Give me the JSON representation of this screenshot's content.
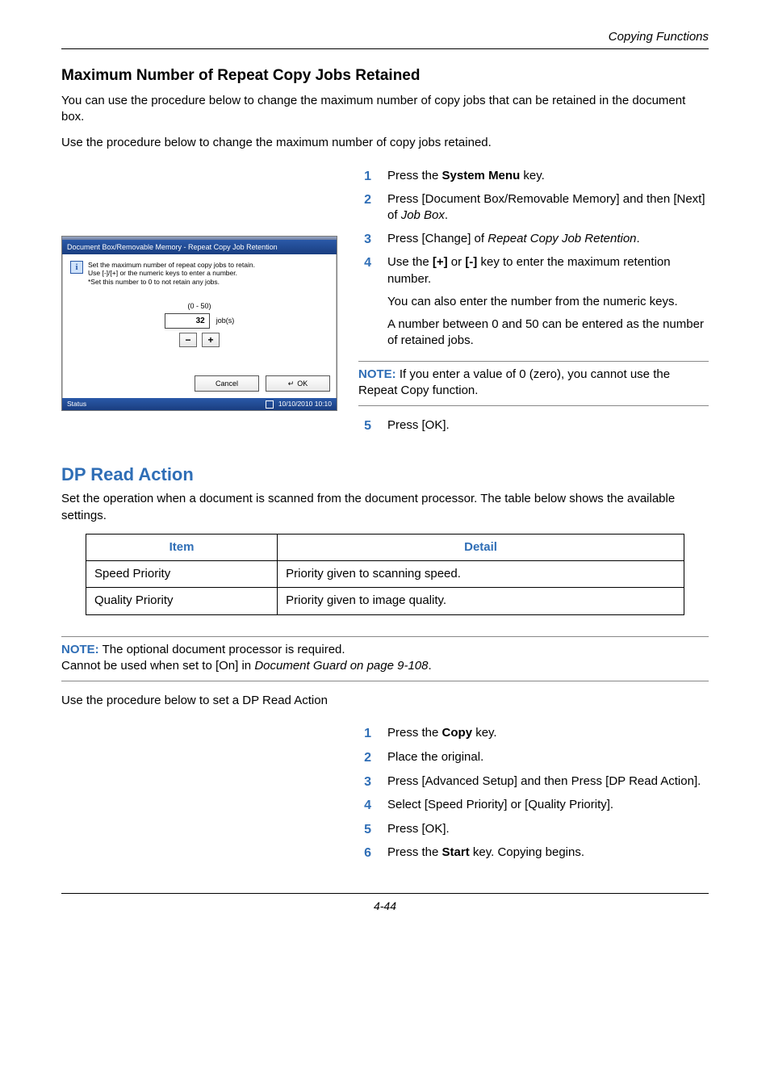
{
  "header": {
    "running": "Copying Functions"
  },
  "section1": {
    "title": "Maximum Number of Repeat Copy Jobs Retained",
    "para1": "You can use the procedure below to change the maximum number of copy jobs that can be retained in the document box.",
    "para2": "Use the procedure below to change the maximum number of copy jobs retained."
  },
  "dialog": {
    "title": "Document Box/Removable Memory - Repeat Copy Job Retention",
    "info1": "Set the maximum number of repeat copy jobs to retain.",
    "info2": "Use [-]/[+] or the numeric keys to enter a number.",
    "info3": "*Set this number to 0 to not retain any jobs.",
    "range": "(0 - 50)",
    "value": "32",
    "unit": "job(s)",
    "cancel": "Cancel",
    "ok": "OK",
    "status": "Status",
    "timestamp": "10/10/2010   10:10"
  },
  "steps1": {
    "s1": {
      "n": "1",
      "t": "Press the ",
      "b": "System Menu",
      "t2": " key."
    },
    "s2": {
      "n": "2",
      "t": "Press [Document Box/Removable Memory] and then [Next] of ",
      "i": "Job Box",
      "t2": "."
    },
    "s3": {
      "n": "3",
      "t": "Press [Change] of ",
      "i": "Repeat Copy Job Retention",
      "t2": "."
    },
    "s4": {
      "n": "4",
      "t": "Use the ",
      "b": "[+]",
      "t2": " or ",
      "b2": "[-]",
      "t3": " key to enter the maximum retention number.",
      "sub1": "You can also enter the number from the numeric keys.",
      "sub2": "A number between 0 and 50 can be entered as the number of retained jobs."
    },
    "s5": {
      "n": "5",
      "t": "Press [OK]."
    }
  },
  "note1": {
    "label": "NOTE:",
    "text": " If you enter a value of 0 (zero), you cannot use the Repeat Copy function."
  },
  "section2": {
    "title": "DP Read Action",
    "para": "Set the operation when a document is scanned from the document processor. The table below shows the available settings."
  },
  "table": {
    "h1": "Item",
    "h2": "Detail",
    "r1c1": "Speed Priority",
    "r1c2": "Priority given to scanning speed.",
    "r2c1": "Quality Priority",
    "r2c2": "Priority given to image quality."
  },
  "note2": {
    "label": "NOTE:",
    "line1": " The optional document processor is required.",
    "line2": "Cannot be used when set to [On] in ",
    "line2i": "Document Guard on page 9-108",
    "line2end": "."
  },
  "para3": "Use the procedure below to set a DP Read Action",
  "steps2": {
    "s1": {
      "n": "1",
      "t": "Press the ",
      "b": "Copy",
      "t2": " key."
    },
    "s2": {
      "n": "2",
      "t": "Place the original."
    },
    "s3": {
      "n": "3",
      "t": "Press [Advanced Setup] and then Press [DP Read Action]."
    },
    "s4": {
      "n": "4",
      "t": "Select [Speed Priority] or [Quality Priority]."
    },
    "s5": {
      "n": "5",
      "t": "Press [OK]."
    },
    "s6": {
      "n": "6",
      "t": "Press the ",
      "b": "Start",
      "t2": " key. Copying begins."
    }
  },
  "pagenum": "4-44"
}
